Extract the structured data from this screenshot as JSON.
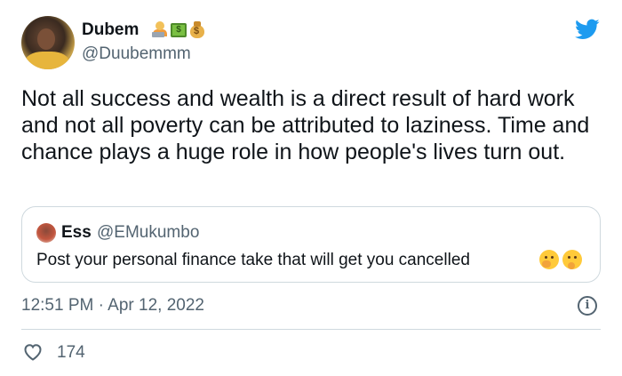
{
  "author": {
    "display_name": "Dubem",
    "handle": "@Duubemmm",
    "name_emojis": [
      "technologist-emoji",
      "dollar-banknote-emoji",
      "money-bag-emoji"
    ]
  },
  "tweet": {
    "text": "Not all success and wealth is a direct result of hard work and not all poverty can be attributed to laziness. Time and chance plays a huge role in how people's lives turn out.",
    "timestamp": "12:51 PM · Apr 12, 2022",
    "likes": "174"
  },
  "quoted_tweet": {
    "display_name": "Ess",
    "handle": "@EMukumbo",
    "text": "Post your personal finance take that will get you cancelled",
    "emojis": [
      "face-with-hand-over-mouth-emoji",
      "thinking-face-emoji"
    ]
  },
  "colors": {
    "twitter_blue": "#1d9bf0",
    "secondary_text": "#536471",
    "border": "#cfd9de"
  },
  "icons": {
    "brand": "twitter-bird-icon",
    "info": "info-icon",
    "like": "heart-icon"
  }
}
